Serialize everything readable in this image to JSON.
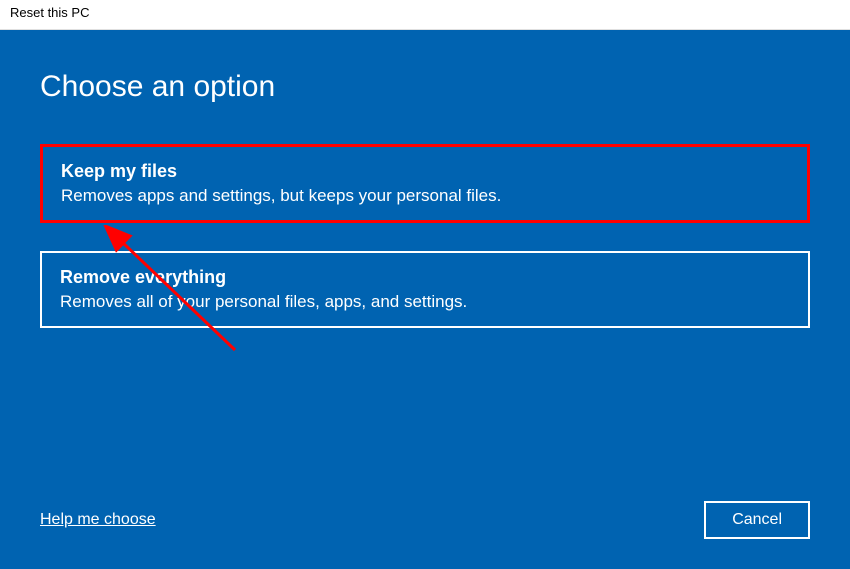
{
  "titlebar": {
    "title": "Reset this PC"
  },
  "main": {
    "heading": "Choose an option",
    "options": [
      {
        "title": "Keep my files",
        "description": "Removes apps and settings, but keeps your personal files."
      },
      {
        "title": "Remove everything",
        "description": "Removes all of your personal files, apps, and settings."
      }
    ]
  },
  "footer": {
    "help_link": "Help me choose",
    "cancel_label": "Cancel"
  },
  "annotation": {
    "highlight_color": "#ff0000",
    "arrow_color": "#ff0000"
  }
}
